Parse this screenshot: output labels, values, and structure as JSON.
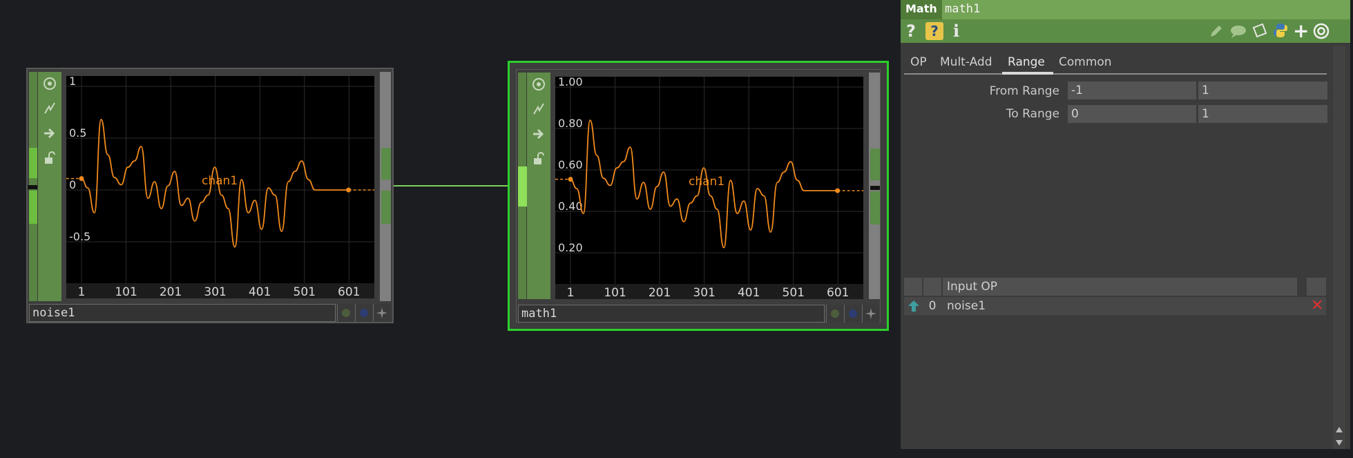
{
  "nodes": [
    {
      "name": "noise1",
      "chan_label": "chan1",
      "y_ticks": [
        "1",
        "0.5",
        "0",
        "-0.5"
      ],
      "x_ticks": [
        "1",
        "101",
        "201",
        "301",
        "401",
        "501",
        "601"
      ]
    },
    {
      "name": "math1",
      "chan_label": "chan1",
      "y_ticks": [
        "1.00",
        "0.80",
        "0.60",
        "0.40",
        "0.20"
      ],
      "x_ticks": [
        "1",
        "101",
        "201",
        "301",
        "401",
        "501",
        "601"
      ]
    }
  ],
  "panel": {
    "op_type": "Math",
    "op_name": "math1",
    "tabs": [
      "OP",
      "Mult-Add",
      "Range",
      "Common"
    ],
    "active_tab": "Range",
    "params": [
      {
        "label": "From Range",
        "v1": "-1",
        "v2": "1"
      },
      {
        "label": "To Range",
        "v1": "0",
        "v2": "1"
      }
    ],
    "input_table": {
      "header": "Input OP",
      "rows": [
        {
          "index": "0",
          "op": "noise1"
        }
      ]
    }
  },
  "colors": {
    "accent": "#74a455",
    "selected": "#2bd12b",
    "curve": "#f08a1c",
    "wire": "#7fd05a"
  },
  "chart_data": {
    "type": "line",
    "series": [
      {
        "name": "chan1",
        "x": [
          1,
          15,
          30,
          45,
          60,
          75,
          90,
          105,
          120,
          135,
          150,
          165,
          180,
          195,
          210,
          225,
          240,
          255,
          270,
          285,
          300,
          315,
          330,
          345,
          360,
          375,
          390,
          405,
          420,
          435,
          450,
          465,
          480,
          495,
          510,
          525,
          540,
          555,
          570,
          585,
          600
        ],
        "values": [
          0.11,
          0.02,
          -0.22,
          0.68,
          0.34,
          0.12,
          0.05,
          0.22,
          0.28,
          0.42,
          -0.08,
          0.08,
          -0.18,
          0.04,
          0.18,
          -0.15,
          -0.08,
          -0.3,
          -0.12,
          -0.05,
          0.22,
          -0.05,
          -0.18,
          -0.55,
          0.1,
          -0.22,
          -0.1,
          -0.38,
          0.02,
          -0.05,
          -0.4,
          0.08,
          0.18,
          0.28,
          0.1,
          0.0,
          0.0,
          0.0,
          0.0,
          0.0,
          0.0
        ]
      }
    ],
    "xlim": [
      1,
      630
    ]
  }
}
